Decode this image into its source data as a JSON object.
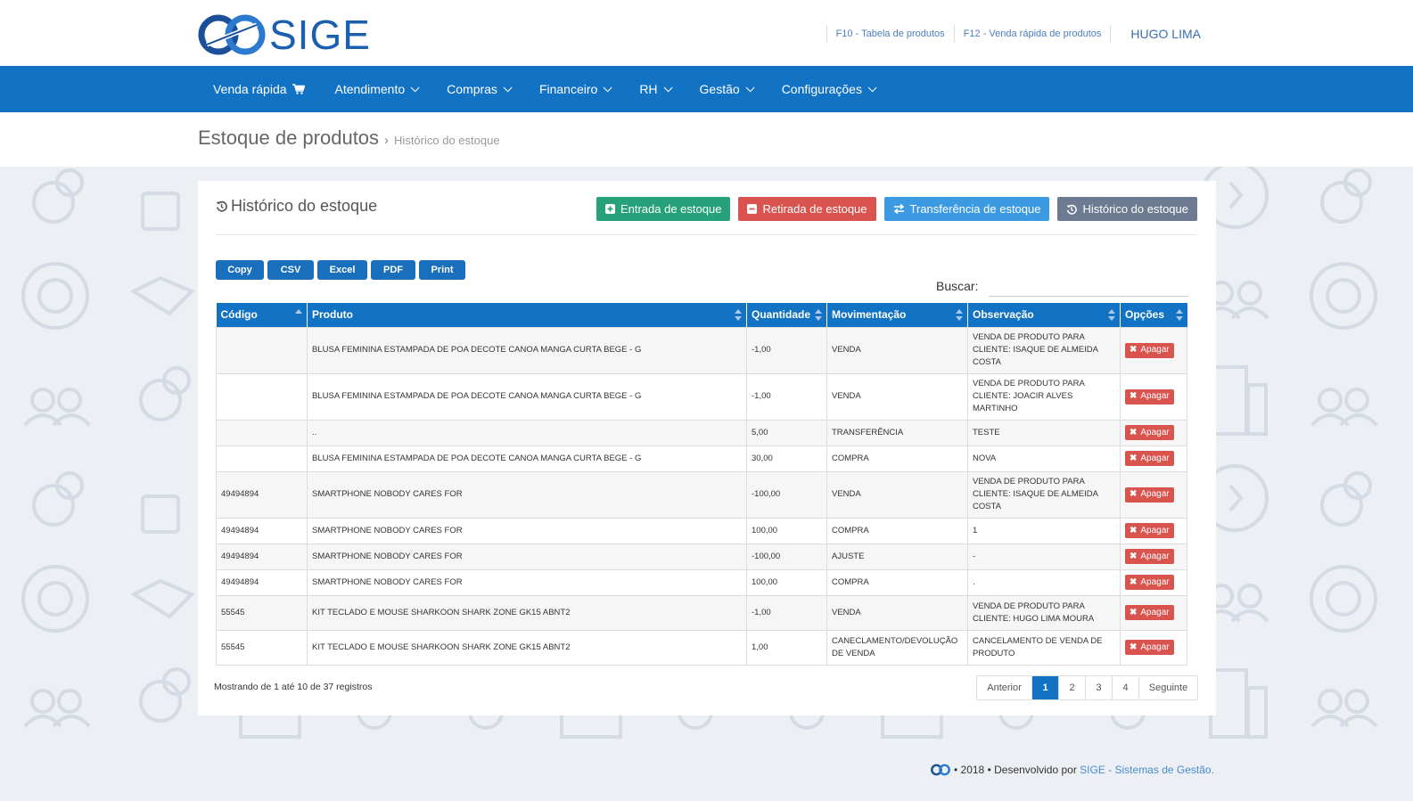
{
  "header": {
    "logo_text": "SIGE",
    "links": [
      "F10 - Tabela de produtos",
      "F12 - Venda rápida de produtos"
    ],
    "user": "HUGO LIMA"
  },
  "nav": {
    "items": [
      {
        "label": "Venda rápida",
        "icon": "cart-icon"
      },
      {
        "label": "Atendimento"
      },
      {
        "label": "Compras"
      },
      {
        "label": "Financeiro"
      },
      {
        "label": "RH"
      },
      {
        "label": "Gestão"
      },
      {
        "label": "Configurações"
      }
    ]
  },
  "breadcrumb": {
    "title": "Estoque de produtos",
    "separator": "›",
    "current": "Histórico do estoque"
  },
  "panel": {
    "title": "Histórico do estoque",
    "actions": [
      {
        "label": "Entrada de estoque",
        "color": "#26a17a"
      },
      {
        "label": "Retirada de estoque",
        "color": "#d9534f"
      },
      {
        "label": "Transferência de estoque",
        "color": "#3c9ae3"
      },
      {
        "label": "Histórico do estoque",
        "color": "#6c7b92"
      }
    ],
    "export_buttons": [
      "Copy",
      "CSV",
      "Excel",
      "PDF",
      "Print"
    ],
    "search_label": "Buscar:",
    "search_value": ""
  },
  "table": {
    "columns": [
      "Código",
      "Produto",
      "Quantidade",
      "Movimentação",
      "Observação",
      "Opções"
    ],
    "delete_label": "Apagar",
    "rows": [
      {
        "codigo": "",
        "produto": "BLUSA FEMININA ESTAMPADA DE POA DECOTE CANOA MANGA CURTA BEGE - G",
        "quantidade": "-1,00",
        "movimentacao": "VENDA",
        "observacao": "VENDA DE PRODUTO PARA CLIENTE: ISAQUE DE ALMEIDA COSTA"
      },
      {
        "codigo": "",
        "produto": "BLUSA FEMININA ESTAMPADA DE POA DECOTE CANOA MANGA CURTA BEGE - G",
        "quantidade": "-1,00",
        "movimentacao": "VENDA",
        "observacao": "VENDA DE PRODUTO PARA CLIENTE: JOACIR ALVES MARTINHO"
      },
      {
        "codigo": "",
        "produto": "..",
        "quantidade": "5,00",
        "movimentacao": "TRANSFERÊNCIA",
        "observacao": "TESTE"
      },
      {
        "codigo": "",
        "produto": "BLUSA FEMININA ESTAMPADA DE POA DECOTE CANOA MANGA CURTA BEGE - G",
        "quantidade": "30,00",
        "movimentacao": "COMPRA",
        "observacao": "NOVA"
      },
      {
        "codigo": "49494894",
        "produto": "SMARTPHONE NOBODY CARES FOR",
        "quantidade": "-100,00",
        "movimentacao": "VENDA",
        "observacao": "VENDA DE PRODUTO PARA CLIENTE: ISAQUE DE ALMEIDA COSTA"
      },
      {
        "codigo": "49494894",
        "produto": "SMARTPHONE NOBODY CARES FOR",
        "quantidade": "100,00",
        "movimentacao": "COMPRA",
        "observacao": "1"
      },
      {
        "codigo": "49494894",
        "produto": "SMARTPHONE NOBODY CARES FOR",
        "quantidade": "-100,00",
        "movimentacao": "AJUSTE",
        "observacao": "-"
      },
      {
        "codigo": "49494894",
        "produto": "SMARTPHONE NOBODY CARES FOR",
        "quantidade": "100,00",
        "movimentacao": "COMPRA",
        "observacao": "."
      },
      {
        "codigo": "55545",
        "produto": "KIT TECLADO E MOUSE SHARKOON SHARK ZONE GK15 ABNT2",
        "quantidade": "-1,00",
        "movimentacao": "VENDA",
        "observacao": "VENDA DE PRODUTO PARA CLIENTE: HUGO LIMA MOURA"
      },
      {
        "codigo": "55545",
        "produto": "KIT TECLADO E MOUSE SHARKOON SHARK ZONE GK15 ABNT2",
        "quantidade": "1,00",
        "movimentacao": "CANECLAMENTO/DEVOLUÇÃO DE VENDA",
        "observacao": "CANCELAMENTO DE VENDA DE PRODUTO"
      }
    ]
  },
  "pagination": {
    "info": "Mostrando de 1 até 10 de 37 registros",
    "previous": "Anterior",
    "pages": [
      "1",
      "2",
      "3",
      "4"
    ],
    "active_page": "1",
    "next": "Seguinte"
  },
  "footer": {
    "text": "• 2018 • Desenvolvido por",
    "link": "SIGE - Sistemas de Gestão."
  },
  "colors": {
    "primary": "#1272c4",
    "danger": "#d9534f",
    "success": "#26a17a",
    "info": "#3c9ae3",
    "muted": "#6c7b92"
  }
}
